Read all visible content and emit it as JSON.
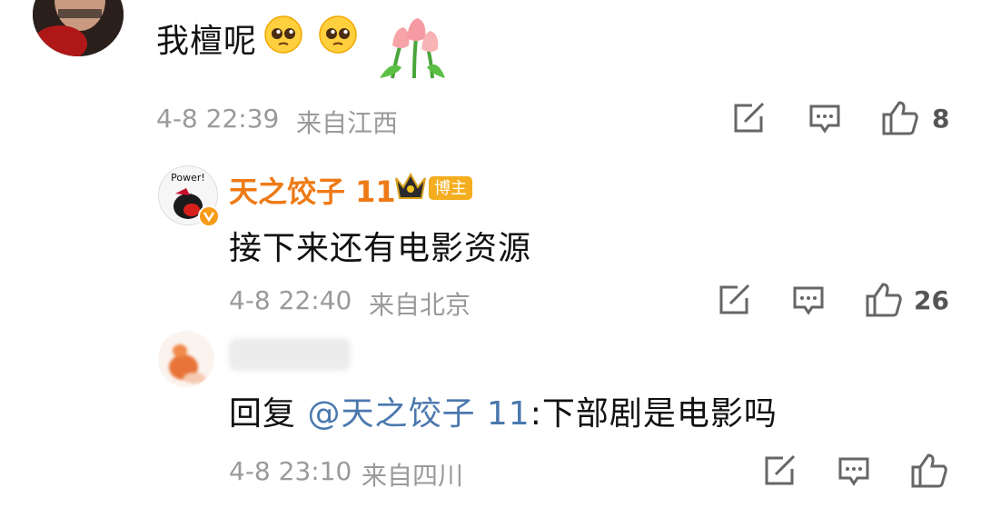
{
  "comments": [
    {
      "text": "我檀呢",
      "time": "4-8 22:39",
      "location": "来自江西",
      "likes": "8"
    },
    {
      "username": "天之饺子 11",
      "badge": "博主",
      "avatar_label": "Power!",
      "text": "接下来还有电影资源",
      "time": "4-8 22:40",
      "location": "来自北京",
      "likes": "26"
    },
    {
      "reply_prefix": "回复 ",
      "mention": "@天之饺子 11",
      "reply_text": ":下部剧是电影吗",
      "time": "4-8 23:10",
      "location": "来自四川"
    }
  ],
  "colors": {
    "username": "#ee7a16",
    "badge": "#f4ad1f",
    "mention": "#4a78ad",
    "meta": "#9a9a9a"
  }
}
